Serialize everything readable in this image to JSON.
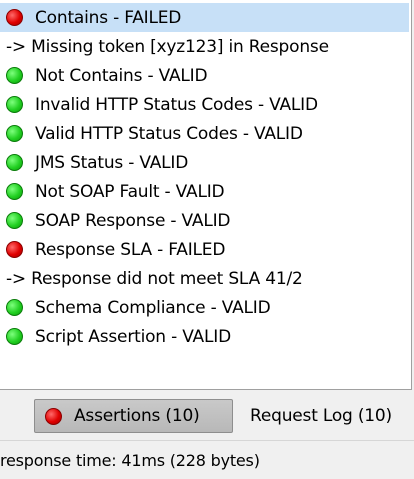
{
  "assertions": {
    "rows": [
      {
        "kind": "item",
        "status": "failed",
        "text": "Contains - FAILED",
        "selected": true
      },
      {
        "kind": "detail",
        "text": "-> Missing token [xyz123] in Response"
      },
      {
        "kind": "item",
        "status": "valid",
        "text": "Not Contains - VALID"
      },
      {
        "kind": "item",
        "status": "valid",
        "text": "Invalid HTTP Status Codes - VALID"
      },
      {
        "kind": "item",
        "status": "valid",
        "text": "Valid HTTP Status Codes - VALID"
      },
      {
        "kind": "item",
        "status": "valid",
        "text": "JMS Status - VALID"
      },
      {
        "kind": "item",
        "status": "valid",
        "text": "Not SOAP Fault - VALID"
      },
      {
        "kind": "item",
        "status": "valid",
        "text": "SOAP Response - VALID"
      },
      {
        "kind": "item",
        "status": "failed",
        "text": "Response SLA - FAILED"
      },
      {
        "kind": "detail",
        "text": "-> Response did not meet SLA 41/2"
      },
      {
        "kind": "item",
        "status": "valid",
        "text": "Schema Compliance - VALID"
      },
      {
        "kind": "item",
        "status": "valid",
        "text": "Script Assertion - VALID"
      }
    ]
  },
  "tabs": {
    "assertions_label": "Assertions (10)",
    "assertions_status": "failed",
    "request_log_label": "Request Log (10)"
  },
  "status_bar": {
    "text": "response time: 41ms (228 bytes)"
  },
  "colors": {
    "failed": "#e00000",
    "valid": "#22d022",
    "selection": "#c7e0f7"
  }
}
